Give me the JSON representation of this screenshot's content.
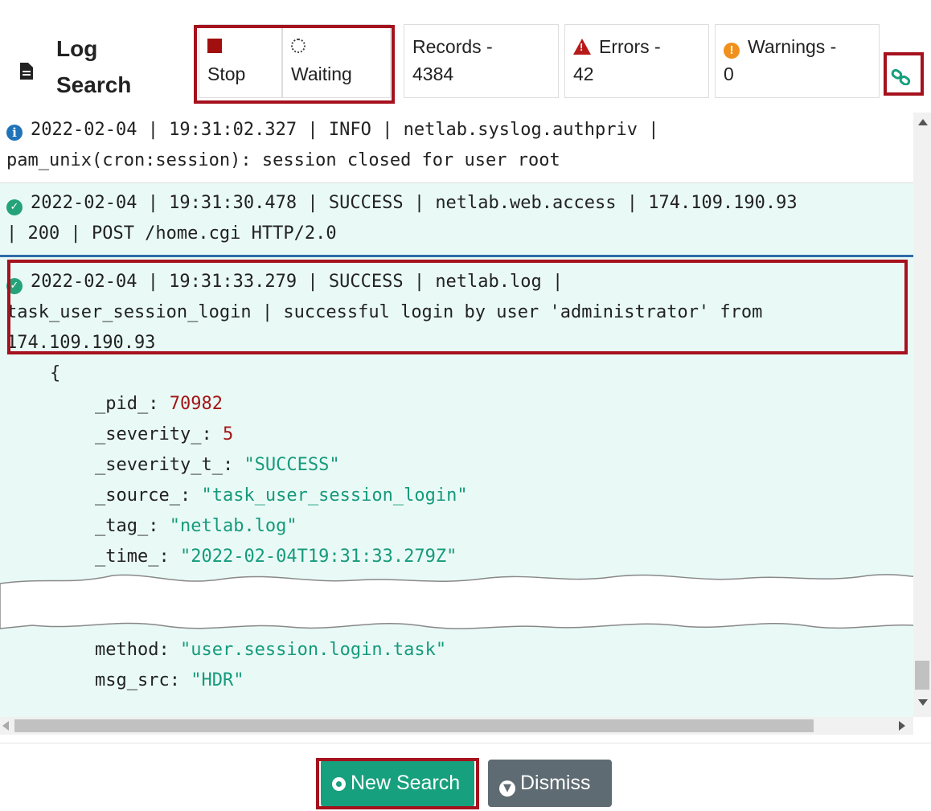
{
  "header": {
    "title": "Log\nSearch",
    "icon": "document-icon",
    "stop": {
      "icon": "stop-square-icon",
      "label": "Stop"
    },
    "waiting": {
      "icon": "spinner-icon",
      "label": "Waiting"
    },
    "records": {
      "label": "Records -",
      "value": "4384"
    },
    "errors": {
      "icon": "warning-triangle-icon",
      "label": "Errors -",
      "value": "42"
    },
    "warnings": {
      "icon": "exclamation-circle-icon",
      "label": "Warnings -",
      "value": "0"
    },
    "link_icon": "link-icon"
  },
  "log": {
    "entries": [
      {
        "icon": "info-icon",
        "line1": "2022-02-04 | 19:31:02.327 | INFO    | netlab.syslog.authpriv |",
        "line2": "pam_unix(cron:session): session closed for user root"
      },
      {
        "icon": "success-icon",
        "line1": "2022-02-04 | 19:31:30.478 | SUCCESS | netlab.web.access | 174.109.190.93",
        "line2": "| 200 | POST /home.cgi HTTP/2.0"
      },
      {
        "icon": "success-icon",
        "line1": "2022-02-04 | 19:31:33.279 | SUCCESS | netlab.log |",
        "line2": "task_user_session_login | successful login by user 'administrator' from",
        "line3": "174.109.190.93"
      }
    ],
    "json": {
      "open": "{",
      "pid_key": "_pid_: ",
      "pid_val": "70982",
      "severity_key": "_severity_: ",
      "severity_val": "5",
      "severity_t_key": "_severity_t_: ",
      "severity_t_val": "\"SUCCESS\"",
      "source_key": "_source_: ",
      "source_val": "\"task_user_session_login\"",
      "tag_key": "_tag_: ",
      "tag_val": "\"netlab.log\"",
      "time_key": "_time_: ",
      "time_val": "\"2022-02-04T19:31:33.279Z\"",
      "method_key": "method: ",
      "method_val": "\"user.session.login.task\"",
      "msg_src_key": "msg_src: ",
      "msg_src_val": "\"HDR\""
    }
  },
  "footer": {
    "new_search": {
      "icon": "gear-icon",
      "label": "New Search"
    },
    "dismiss": {
      "icon": "arrow-down-circle-icon",
      "label": "Dismiss"
    }
  },
  "colors": {
    "highlight_border": "#a5111d",
    "success_bg": "#e9faf6",
    "success_green": "#17a07d",
    "info_blue": "#2073b8",
    "error_red": "#b81919",
    "warning_orange": "#f0901d"
  }
}
